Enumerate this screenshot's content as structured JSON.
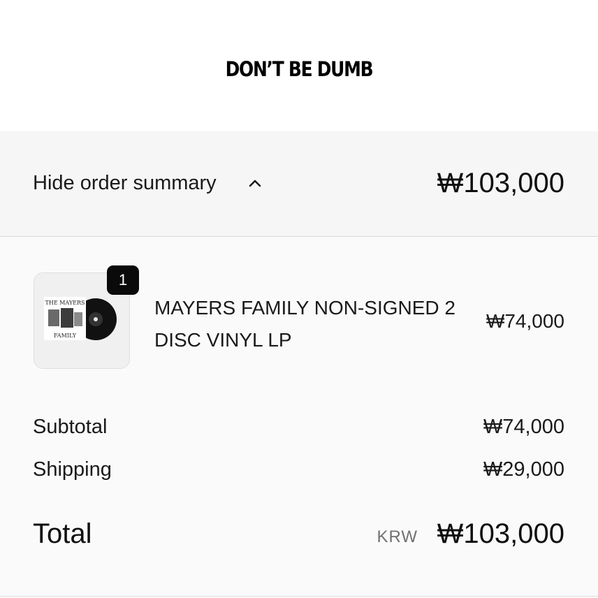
{
  "header": {
    "logo_text": "DON’T BE DUMB"
  },
  "summary_toggle": {
    "label": "Hide order summary",
    "icon": "chevron-up-icon",
    "total": "₩103,000"
  },
  "line_items": [
    {
      "name": "MAYERS FAMILY NON-SIGNED 2 DISC VINYL LP",
      "quantity": "1",
      "price": "₩74,000",
      "thumbnail_text_top": "THE MAYERS",
      "thumbnail_text_bottom": "FAMILY"
    }
  ],
  "totals": {
    "subtotal_label": "Subtotal",
    "subtotal_value": "₩74,000",
    "shipping_label": "Shipping",
    "shipping_value": "₩29,000",
    "total_label": "Total",
    "currency_code": "KRW",
    "total_value": "₩103,000"
  },
  "colors": {
    "summary_bg": "#f6f6f6",
    "badge_bg": "#0a0a0a",
    "muted_text": "#707070"
  }
}
